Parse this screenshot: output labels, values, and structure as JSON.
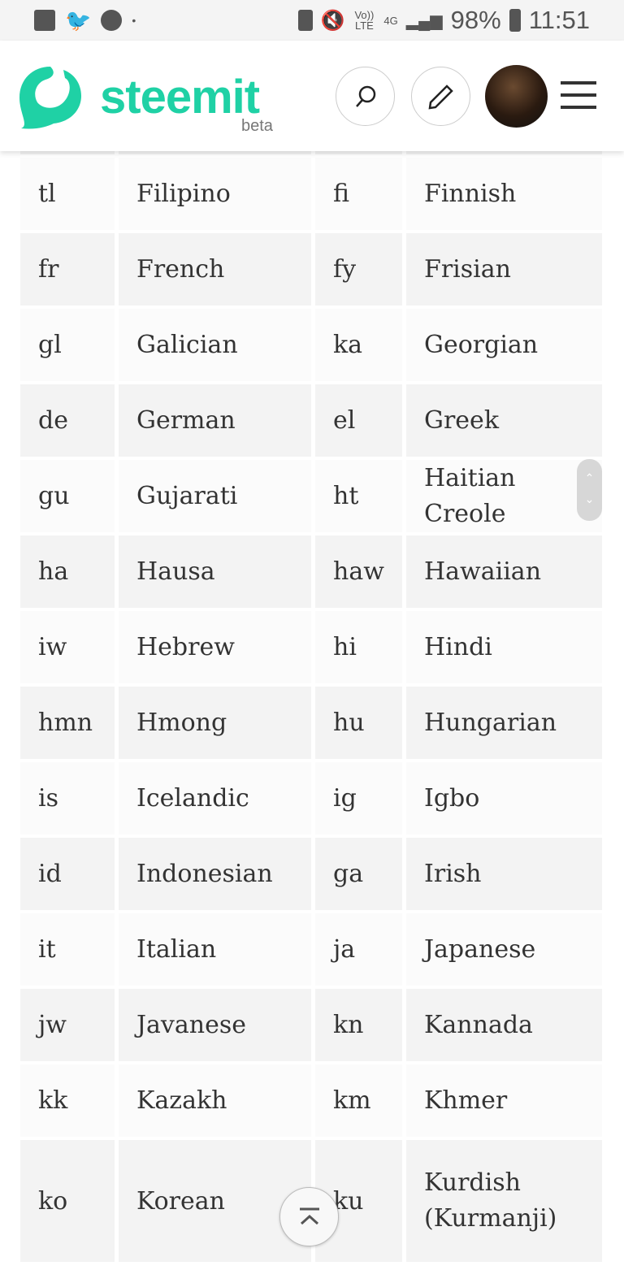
{
  "status_bar": {
    "battery": "98%",
    "time": "11:51",
    "network": "4G",
    "volte": "Vo)) LTE"
  },
  "header": {
    "brand": "steemit",
    "beta": "beta",
    "accent": "#1fd1a5"
  },
  "table": {
    "rows": [
      [
        "",
        "",
        "",
        ""
      ],
      [
        "tl",
        "Filipino",
        "fi",
        "Finnish"
      ],
      [
        "fr",
        "French",
        "fy",
        "Frisian"
      ],
      [
        "gl",
        "Galician",
        "ka",
        "Georgian"
      ],
      [
        "de",
        "German",
        "el",
        "Greek"
      ],
      [
        "gu",
        "Gujarati",
        "ht",
        "Haitian Creole"
      ],
      [
        "ha",
        "Hausa",
        "haw",
        "Hawaiian"
      ],
      [
        "iw",
        "Hebrew",
        "hi",
        "Hindi"
      ],
      [
        "hmn",
        "Hmong",
        "hu",
        "Hungarian"
      ],
      [
        "is",
        "Icelandic",
        "ig",
        "Igbo"
      ],
      [
        "id",
        "Indonesian",
        "ga",
        "Irish"
      ],
      [
        "it",
        "Italian",
        "ja",
        "Japanese"
      ],
      [
        "jw",
        "Javanese",
        "kn",
        "Kannada"
      ],
      [
        "kk",
        "Kazakh",
        "km",
        "Khmer"
      ],
      [
        "ko",
        "Korean",
        "ku",
        "Kurdish (Kurmanji)"
      ]
    ]
  }
}
